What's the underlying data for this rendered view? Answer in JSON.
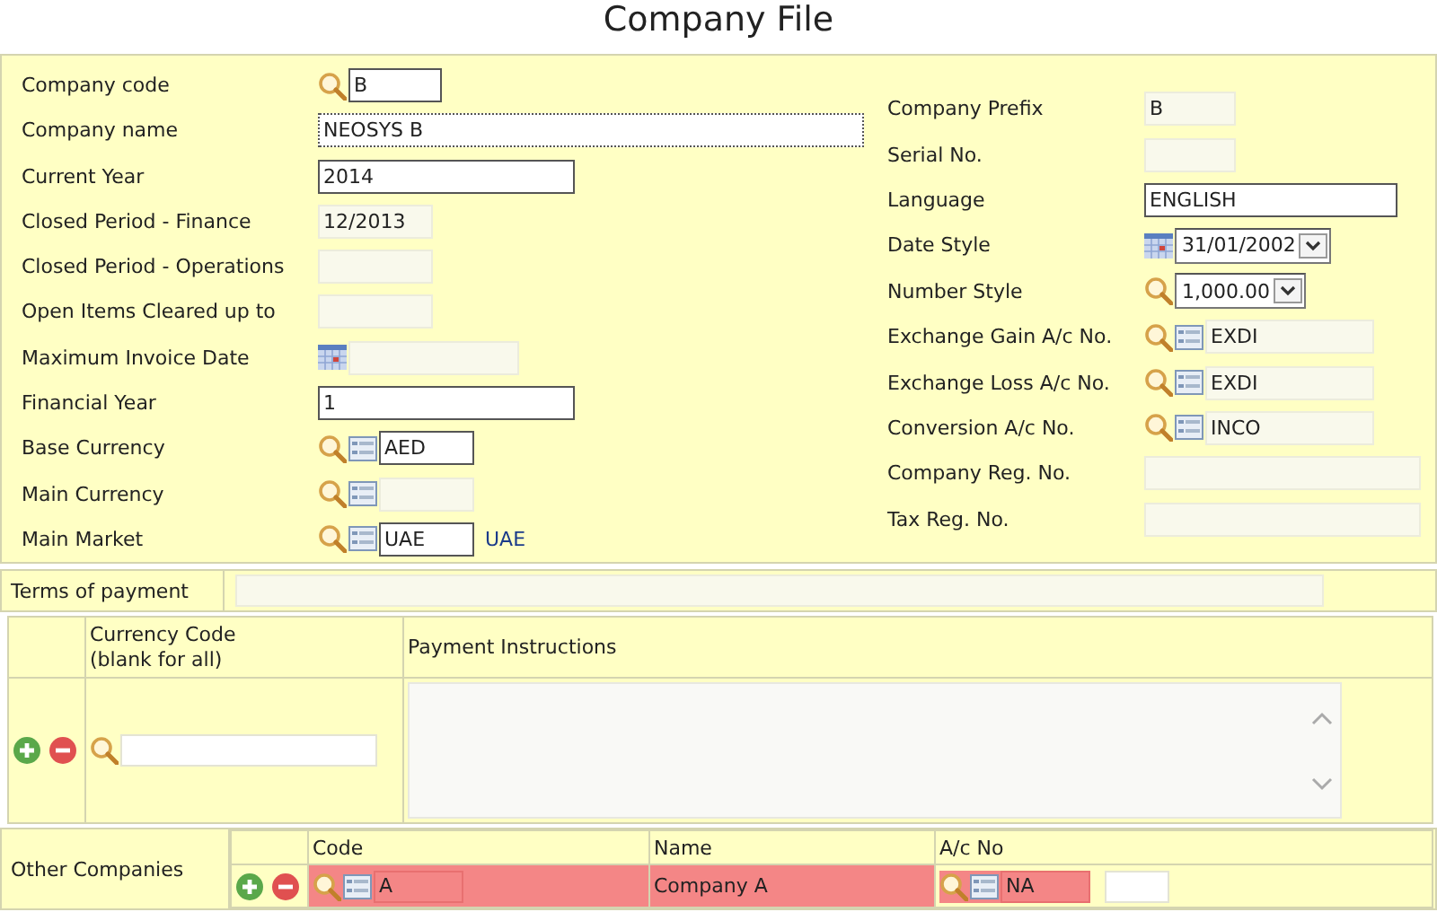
{
  "title": "Company File",
  "left_fields": [
    {
      "label": "Company code",
      "kind": "text",
      "value": "B",
      "lookup": true
    },
    {
      "label": "Company name",
      "kind": "focused",
      "value": "NEOSYS B"
    },
    {
      "label": "Current Year",
      "kind": "text",
      "value": "2014"
    },
    {
      "label": "Closed Period - Finance",
      "kind": "readonly",
      "value": "12/2013"
    },
    {
      "label": "Closed Period - Operations",
      "kind": "readonly"
    },
    {
      "label": "Open Items Cleared up to",
      "kind": "readonly"
    },
    {
      "label": "Maximum Invoice Date",
      "kind": "readonly",
      "calendar": true
    },
    {
      "label": "Financial Year",
      "kind": "text",
      "value": "1"
    },
    {
      "label": "Base Currency",
      "kind": "text",
      "value": "AED",
      "lookup": true,
      "list": true
    },
    {
      "label": "Main Currency",
      "kind": "readonly",
      "lookup": true,
      "list": true
    },
    {
      "label": "Main Market",
      "kind": "text",
      "value": "UAE",
      "lookup": true,
      "list": true,
      "note": "UAE"
    }
  ],
  "right_fields": [
    {
      "label": "Company Prefix",
      "kind": "readonly",
      "value": "B"
    },
    {
      "label": "Serial No.",
      "kind": "readonly"
    },
    {
      "label": "Language",
      "kind": "text",
      "value": "ENGLISH"
    },
    {
      "label": "Date Style",
      "kind": "select",
      "value": "31/01/2002",
      "calendar": true
    },
    {
      "label": "Number Style",
      "kind": "select",
      "value": "1,000.00",
      "lookup": true
    },
    {
      "label": "Exchange Gain A/c No.",
      "kind": "readonly",
      "value": "EXDI",
      "lookup": true,
      "list": true
    },
    {
      "label": "Exchange Loss A/c No.",
      "kind": "readonly",
      "value": "EXDI",
      "lookup": true,
      "list": true
    },
    {
      "label": "Conversion A/c No.",
      "kind": "readonly",
      "value": "INCO",
      "lookup": true,
      "list": true
    },
    {
      "label": "Company Reg. No.",
      "kind": "readonly"
    },
    {
      "label": "Tax Reg. No.",
      "kind": "readonly"
    }
  ],
  "terms_of_payment": {
    "label": "Terms of payment"
  },
  "payment_table": {
    "columns": [
      "Currency Code\n(blank for all)",
      "Payment Instructions"
    ],
    "rows": [
      {
        "currency": {
          "lookup": true
        }
      }
    ]
  },
  "other_companies": {
    "label": "Other Companies",
    "columns": [
      "Code",
      "Name",
      "A/c No"
    ],
    "rows": [
      {
        "highlighted": true,
        "code": {
          "value": "A",
          "lookup": true,
          "list": true
        },
        "name": "Company A",
        "account": {
          "value": "NA",
          "lookup": true,
          "list": true
        }
      }
    ]
  }
}
